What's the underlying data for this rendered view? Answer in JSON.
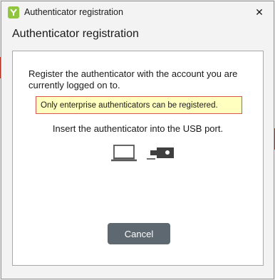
{
  "window": {
    "title": "Authenticator registration",
    "heading": "Authenticator registration"
  },
  "panel": {
    "message": "Register the authenticator with the account you are currently logged on to.",
    "notice": "Only enterprise authenticators can be registered.",
    "instruction": "Insert the authenticator into the USB port.",
    "icons": [
      "laptop-icon",
      "usb-key-icon"
    ]
  },
  "buttons": {
    "cancel_label": "Cancel",
    "close_glyph": "✕"
  },
  "colors": {
    "notice_bg": "#ffffc0",
    "notice_border": "#d9534f",
    "button_bg": "#5e6870",
    "app_icon": "#8fc63e"
  }
}
